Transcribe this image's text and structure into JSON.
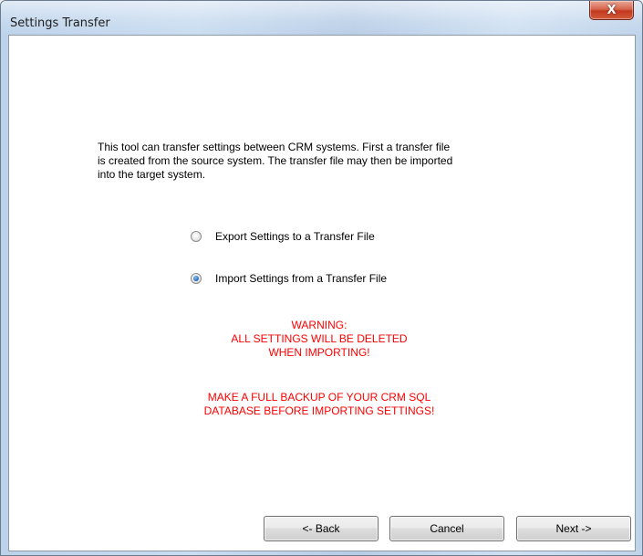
{
  "window": {
    "title": "Settings Transfer",
    "close_glyph": "X"
  },
  "content": {
    "description": "This tool can transfer settings between CRM systems. First a transfer file\nis created from the source system. The transfer file may then be imported\ninto the target system.",
    "options": [
      {
        "label": "Export Settings to a Transfer File",
        "selected": false
      },
      {
        "label": "Import Settings from a Transfer File",
        "selected": true
      }
    ],
    "warning_1": "WARNING:\nALL SETTINGS WILL BE DELETED\nWHEN IMPORTING!",
    "warning_2": "MAKE A FULL BACKUP OF YOUR CRM SQL\nDATABASE BEFORE IMPORTING SETTINGS!",
    "warning_color": "#ff0000"
  },
  "buttons": {
    "back": "<- Back",
    "cancel": "Cancel",
    "next": "Next ->"
  }
}
